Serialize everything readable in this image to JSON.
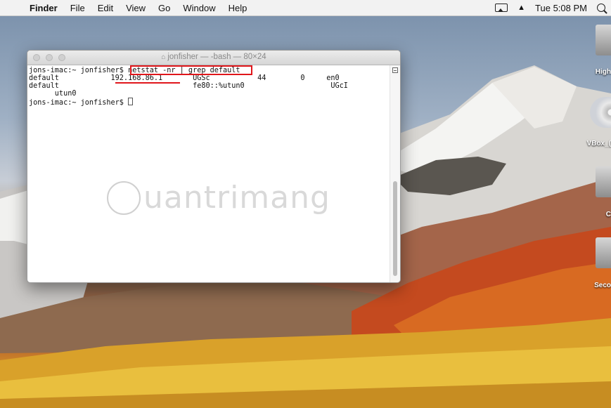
{
  "menubar": {
    "apple_glyph": "",
    "app_name": "Finder",
    "menus": [
      "File",
      "Edit",
      "View",
      "Go",
      "Window",
      "Help"
    ],
    "clock": "Tue 5:08 PM",
    "icons": [
      "airplay-icon",
      "eject-icon",
      "spotlight-search-icon"
    ]
  },
  "terminal": {
    "title": "jonfisher — -bash — 80×24",
    "lines": [
      "jons-imac:~ jonfisher$ netstat -nr | grep default",
      "default            192.168.86.1       UGSc           44        0     en0",
      "default                               fe80::%utun0                    UGcI",
      "      utun0",
      "jons-imac:~ jonfisher$ "
    ],
    "highlighted_command": "netstat -nr | grep default",
    "highlighted_gateway": "192.168.86.1"
  },
  "desktop_icons": [
    {
      "label": "High",
      "icon": "hard-drive-icon"
    },
    {
      "label": "VBox_(",
      "icon": "disc-icon"
    },
    {
      "label": "C",
      "icon": "hard-drive-icon"
    },
    {
      "label": "Seco",
      "icon": "hard-drive-icon"
    }
  ],
  "watermark": {
    "text": "uantrimang"
  },
  "colors": {
    "highlight": "#e0161b",
    "menubar_bg": "#f2f2f2"
  }
}
